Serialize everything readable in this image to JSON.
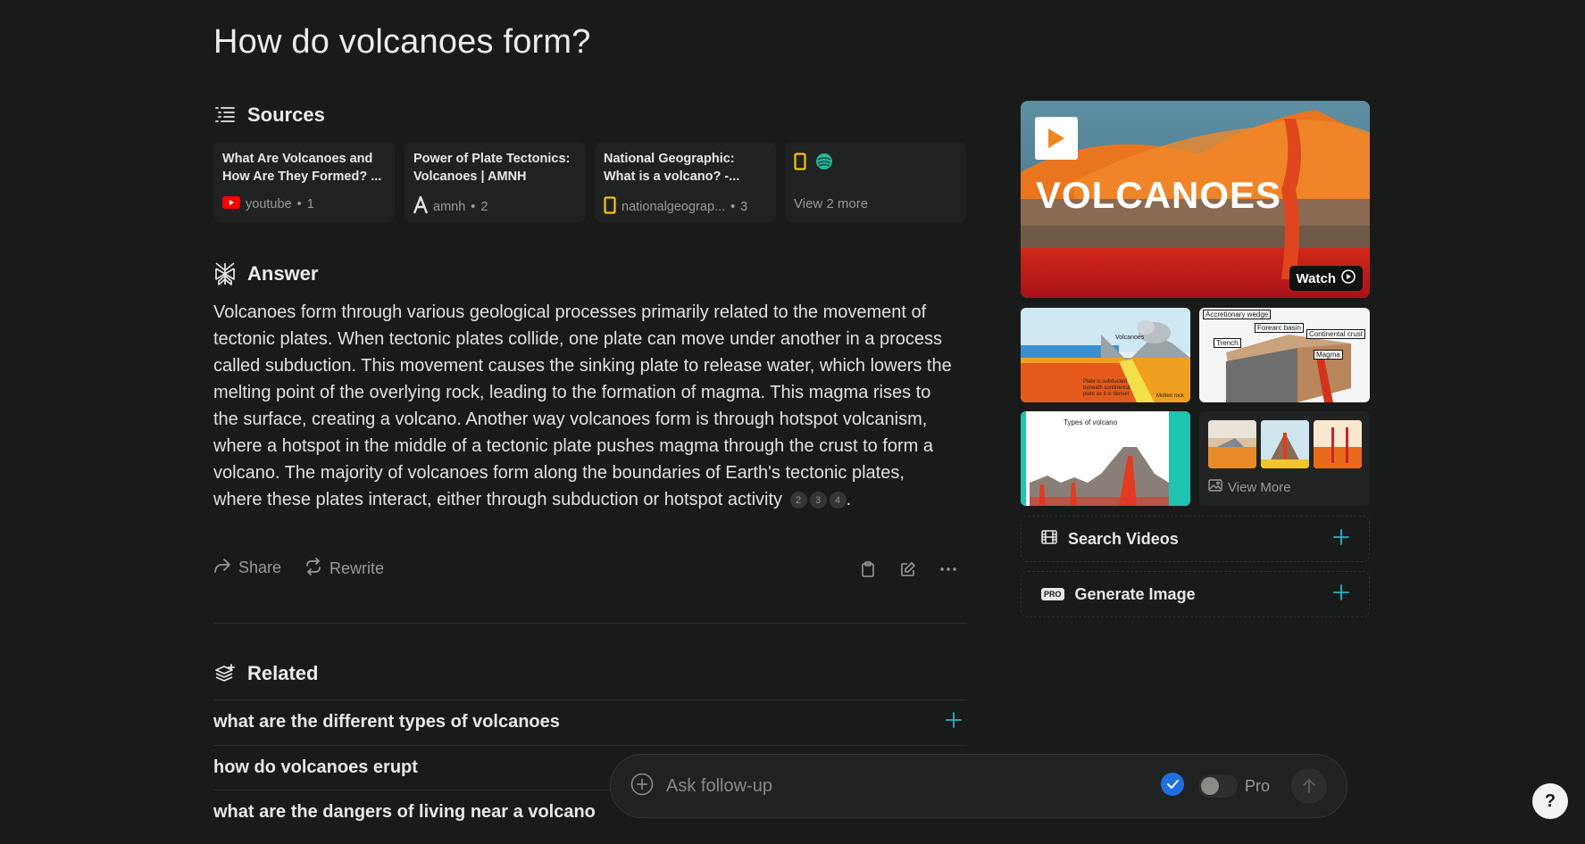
{
  "query": "How do volcanoes form?",
  "sources": {
    "heading": "Sources",
    "items": [
      {
        "title": "What Are Volcanoes and How Are They Formed? ...",
        "site": "youtube",
        "num": "1"
      },
      {
        "title": "Power of Plate Tectonics: Volcanoes | AMNH",
        "site": "amnh",
        "num": "2"
      },
      {
        "title": "National Geographic: What is a volcano? -...",
        "site": "nationalgeograp...",
        "num": "3"
      }
    ],
    "more_label": "View 2 more"
  },
  "answer": {
    "heading": "Answer",
    "text": "Volcanoes form through various geological processes primarily related to the movement of tectonic plates. When tectonic plates collide, one plate can move under another in a process called subduction. This movement causes the sinking plate to release water, which lowers the melting point of the overlying rock, leading to the formation of magma. This magma rises to the surface, creating a volcano. Another way volcanoes form is through hotspot volcanism, where a hotspot in the middle of a tectonic plate pushes magma through the crust to form a volcano. The majority of volcanoes form along the boundaries of Earth's tectonic plates, where these plates interact, either through subduction or hotspot activity",
    "citations": [
      "2",
      "3",
      "4"
    ],
    "end_punct": ".",
    "share_label": "Share",
    "rewrite_label": "Rewrite"
  },
  "related": {
    "heading": "Related",
    "items": [
      "what are the different types of volcanoes",
      "how do volcanoes erupt",
      "what are the dangers of living near a volcano"
    ]
  },
  "media": {
    "video_title": "VOLCANOES",
    "watch_label": "Watch",
    "image1_labels": [
      "Volcanoes",
      "Plate is subducted beneath continental plate as it is denser",
      "Molten rock"
    ],
    "image2_labels": [
      "Accretionary wedge",
      "Forearc basin",
      "Continental crust",
      "Trench",
      "Magma"
    ],
    "image3_title": "Types of volcano",
    "view_more_label": "View More",
    "search_videos_label": "Search Videos",
    "generate_image_label": "Generate Image",
    "pro_badge": "PRO"
  },
  "followup": {
    "placeholder": "Ask follow-up",
    "pro_label": "Pro"
  },
  "help_label": "?"
}
